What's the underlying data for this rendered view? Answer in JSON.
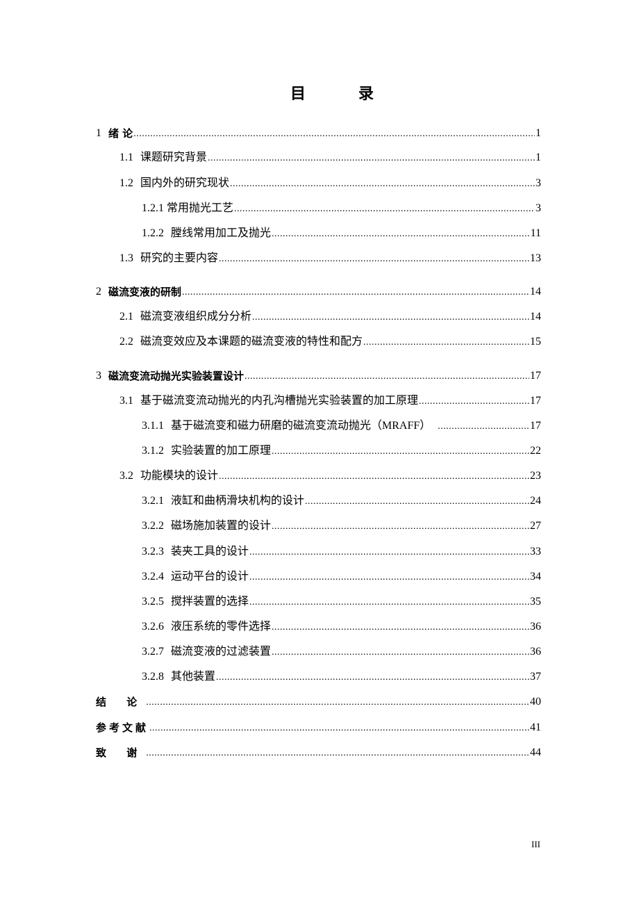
{
  "page_title": [
    "目",
    "录"
  ],
  "toc": [
    {
      "level": 1,
      "num": "1",
      "label": "绪 论",
      "page": "1"
    },
    {
      "level": 2,
      "num": "1.1",
      "label": "课题研究背景",
      "page": "1"
    },
    {
      "level": 2,
      "num": "1.2",
      "label": "国内外的研究现状",
      "page": "3"
    },
    {
      "level": 3,
      "num": "1.2.1",
      "label": "常用抛光工艺",
      "page": "3"
    },
    {
      "level": 3,
      "num": "1.2.2",
      "label": "膛线常用加工及抛光",
      "page": "11"
    },
    {
      "level": 2,
      "num": "1.3",
      "label": "研究的主要内容",
      "page": "13"
    },
    {
      "level": 1,
      "num": "2",
      "label": "磁流变液的研制",
      "page": "14"
    },
    {
      "level": 2,
      "num": "2.1",
      "label": "磁流变液组织成分分析",
      "page": "14"
    },
    {
      "level": 2,
      "num": "2.2",
      "label": "磁流变效应及本课题的磁流变液的特性和配方",
      "page": "15"
    },
    {
      "level": 1,
      "num": "3",
      "label": "磁流变流动抛光实验装置设计",
      "page": "17"
    },
    {
      "level": 2,
      "num": "3.1",
      "label": "基于磁流变流动抛光的内孔沟槽抛光实验装置的加工原理",
      "page": "17"
    },
    {
      "level": 3,
      "num": "3.1.1",
      "label": "基于磁流变和磁力研磨的磁流变流动抛光（MRAFF）",
      "page": "17"
    },
    {
      "level": 3,
      "num": "3.1.2",
      "label": "实验装置的加工原理",
      "page": "22"
    },
    {
      "level": 2,
      "num": "3.2",
      "label": "功能模块的设计",
      "page": "23"
    },
    {
      "level": 3,
      "num": "3.2.1",
      "label": "液缸和曲柄滑块机构的设计",
      "page": "24"
    },
    {
      "level": 3,
      "num": "3.2.2",
      "label": "磁场施加装置的设计",
      "page": "27"
    },
    {
      "level": 3,
      "num": "3.2.3",
      "label": "装夹工具的设计",
      "page": "33"
    },
    {
      "level": 3,
      "num": "3.2.4",
      "label": "运动平台的设计",
      "page": "34"
    },
    {
      "level": 3,
      "num": "3.2.5",
      "label": "搅拌装置的选择",
      "page": "35"
    },
    {
      "level": 3,
      "num": "3.2.6",
      "label": "液压系统的零件选择",
      "page": "36"
    },
    {
      "level": 3,
      "num": "3.2.7",
      "label": "磁流变液的过滤装置",
      "page": "36"
    },
    {
      "level": 3,
      "num": "3.2.8",
      "label": "其他装置",
      "page": "37"
    },
    {
      "level": 0,
      "num": "",
      "label": "结 论",
      "page": "40"
    },
    {
      "level": 0,
      "num": "",
      "label": "参考文献",
      "page": "41"
    },
    {
      "level": 0,
      "num": "",
      "label": "致 谢",
      "page": "44"
    }
  ],
  "folio": "III"
}
